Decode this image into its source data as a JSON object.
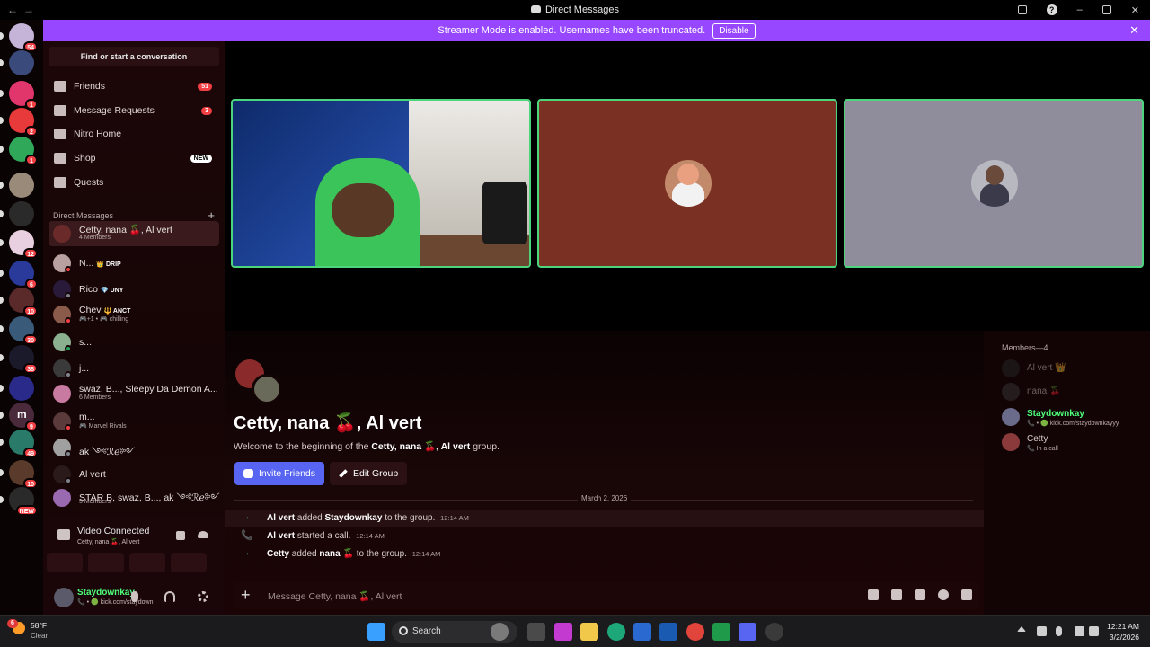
{
  "window": {
    "title": "Direct Messages",
    "back_glyph": "←",
    "forward_glyph": "→",
    "minimize_glyph": "–",
    "close_glyph": "✕",
    "help_glyph": "?"
  },
  "banner": {
    "text": "Streamer Mode is enabled. Usernames have been truncated.",
    "button": "Disable",
    "close_glyph": "✕",
    "color": "#9747ff"
  },
  "servers": [
    {
      "badge": "54",
      "color": "#c6b3d8"
    },
    {
      "badge": "",
      "color": "#3a4a7a"
    },
    {
      "badge": "1",
      "color": "#e0366c"
    },
    {
      "badge": "2",
      "color": "#e83a3a"
    },
    {
      "badge": "1",
      "color": "#2fa85a"
    },
    {
      "badge": "",
      "color": "#9a8a7a"
    },
    {
      "badge": "",
      "color": "#2a2a2a"
    },
    {
      "badge": "12",
      "color": "#e8d0e0"
    },
    {
      "badge": "6",
      "color": "#2a3a9a"
    },
    {
      "badge": "10",
      "color": "#5a2a2a"
    },
    {
      "badge": "30",
      "color": "#3a5a7a"
    },
    {
      "badge": "38",
      "color": "#1a1a2a"
    },
    {
      "badge": "",
      "color": "#2a2a8a"
    },
    {
      "badge": "9",
      "color": "#4a2a3a",
      "letter": "m"
    },
    {
      "badge": "49",
      "color": "#2a7a6a"
    },
    {
      "badge": "10",
      "color": "#5a3a2a"
    },
    {
      "badge": "NEW",
      "color": "#2a2a2a"
    }
  ],
  "sidebar": {
    "search_placeholder": "Find or start a conversation",
    "nav": [
      {
        "label": "Friends",
        "badge": "51"
      },
      {
        "label": "Message Requests",
        "badge": "3"
      },
      {
        "label": "Nitro Home",
        "badge": ""
      },
      {
        "label": "Shop",
        "badge": "NEW"
      },
      {
        "label": "Quests",
        "badge": ""
      }
    ],
    "dm_header": "Direct Messages",
    "dm_add_glyph": "+",
    "dms": [
      {
        "name": "Cetty, nana 🍒, Al vert",
        "sub": "4 Members",
        "tag": "",
        "color": "#6a2a2a"
      },
      {
        "name": "N...",
        "sub": "",
        "tag": "👑 DRIP",
        "color": "#b8a0a0"
      },
      {
        "name": "Rico",
        "sub": "",
        "tag": "💎 UNY",
        "color": "#2a1a3a"
      },
      {
        "name": "Chev",
        "sub": "🎮+1 • 🎮 chilling",
        "tag": "🔱 ANCT",
        "color": "#8a5a4a"
      },
      {
        "name": "s...",
        "sub": "",
        "tag": "",
        "color": "#8ab090"
      },
      {
        "name": "j...",
        "sub": "",
        "tag": "",
        "color": "#3a3a3a"
      },
      {
        "name": "swaz, B..., Sleepy Da Demon A...",
        "sub": "6 Members",
        "tag": "",
        "color": "#c87aa0"
      },
      {
        "name": "m...",
        "sub": "🎮 Marvel Rivals",
        "tag": "",
        "color": "#5a3a3a"
      },
      {
        "name": "ak ༺ℛℯ༻",
        "sub": "",
        "tag": "",
        "color": "#a0a0a0"
      },
      {
        "name": "Al vert",
        "sub": "",
        "tag": "",
        "color": "#2a1a1a"
      },
      {
        "name": "STAR B, swaz, B..., ak ༺ℛℯ༻",
        "sub": "5 Members",
        "tag": "",
        "color": "#9a6ab0"
      }
    ]
  },
  "voice": {
    "status": "Video Connected",
    "channel": "Cetty, nana 🍒, Al vert"
  },
  "user": {
    "name": "Staydownkay",
    "status": "📞 • 🟢 kick.com/staydown"
  },
  "call_tiles": [
    {
      "kind": "video",
      "bg": "#1f3f8a"
    },
    {
      "kind": "avatar",
      "bg": "#7a3022"
    },
    {
      "kind": "avatar",
      "bg": "#8f8c9c"
    }
  ],
  "chat": {
    "title": "Cetty, nana 🍒, Al vert",
    "welcome_pre": "Welcome to the beginning of the",
    "welcome_name": "Cetty, nana 🍒, Al vert",
    "welcome_post": "group.",
    "invite_button": "Invite Friends",
    "edit_button": "Edit Group",
    "date": "March 2, 2026",
    "messages": [
      {
        "icon": "→",
        "actor": "Al vert",
        "action": "added",
        "target": "Staydownkay",
        "rest": "to the group.",
        "time": "12:14 AM"
      },
      {
        "icon": "📞",
        "actor": "Al vert",
        "action": "started a call.",
        "target": "",
        "rest": "",
        "time": "12:14 AM"
      },
      {
        "icon": "→",
        "actor": "Cetty",
        "action": "added",
        "target": "nana 🍒",
        "rest": "to the group.",
        "time": "12:14 AM"
      }
    ],
    "composer_placeholder": "Message Cetty, nana 🍒, Al vert"
  },
  "members": {
    "header": "Members—4",
    "list": [
      {
        "name": "Al vert 👑",
        "sub": "",
        "color": "#2a2a2a"
      },
      {
        "name": "nana 🍒",
        "sub": "",
        "color": "#3a3a3a"
      },
      {
        "name": "Staydownkay",
        "sub": "📞 • 🟢 kick.com/staydownkayyy",
        "color": "#6a6a8a"
      },
      {
        "name": "Cetty",
        "sub": "📞 In a call",
        "color": "#8a3a3a"
      }
    ]
  },
  "taskbar": {
    "weather_temp": "58°F",
    "weather_cond": "Clear",
    "weather_badge": "6",
    "search": "Search",
    "time": "12:21 AM",
    "date": "3/2/2026"
  }
}
